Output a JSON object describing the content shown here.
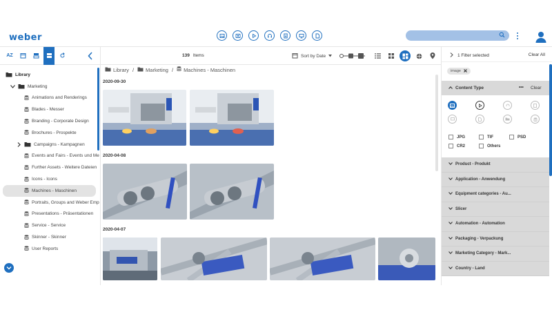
{
  "header": {
    "logo_text": "weber",
    "nav_icons": [
      "images-icon",
      "photo-icon",
      "video-icon",
      "audio-icon",
      "document-icon",
      "presentation-icon",
      "file-icon"
    ],
    "search_placeholder": "",
    "accent": "#1f6fbf"
  },
  "left_toolbar": {
    "sort_az_label": "AZ",
    "icons": [
      "sort-az-icon",
      "calendar-icon",
      "stack-icon",
      "list-view-icon",
      "refresh-icon",
      "collapse-left-icon"
    ]
  },
  "tree": {
    "root": "Library",
    "marketing": "Marketing",
    "items": [
      "Animations and Renderings",
      "Blades - Messer",
      "Branding - Corporate Design",
      "Brochures - Prospekte",
      "Campaigns - Kampagnen",
      "Events and Fairs - Events und Me",
      "Further Assets - Weitere Dateien",
      "Icons - Icons",
      "Machines - Maschinen",
      "Portraits, Groups and Weber Emp",
      "Presentations - Präsentationen",
      "Service - Service",
      "Skinner - Skinner",
      "User Reports"
    ],
    "selected": "Machines - Maschinen"
  },
  "main": {
    "count": "139",
    "count_label": "Items",
    "sort_label": "Sort by Date",
    "breadcrumb": [
      "Library",
      "Marketing",
      "Machines - Maschinen"
    ],
    "groups": [
      "2020-09-30",
      "2020-04-08",
      "2020-04-07"
    ]
  },
  "filters": {
    "selected_count_label": "1 Filter selected",
    "clear_all": "Clear All",
    "chip": "image",
    "content_type_label": "Content Type",
    "more": "•••",
    "clear": "Clear",
    "formats": [
      "JPG",
      "TIF",
      "PSD",
      "CR2",
      "Others"
    ],
    "facets": [
      "Product - Produkt",
      "Application - Anwendung",
      "Equipment categories - Au...",
      "Slicer",
      "Automation - Automation",
      "Packaging - Verpackung",
      "Marketing Category - Mark...",
      "Country - Land"
    ]
  }
}
